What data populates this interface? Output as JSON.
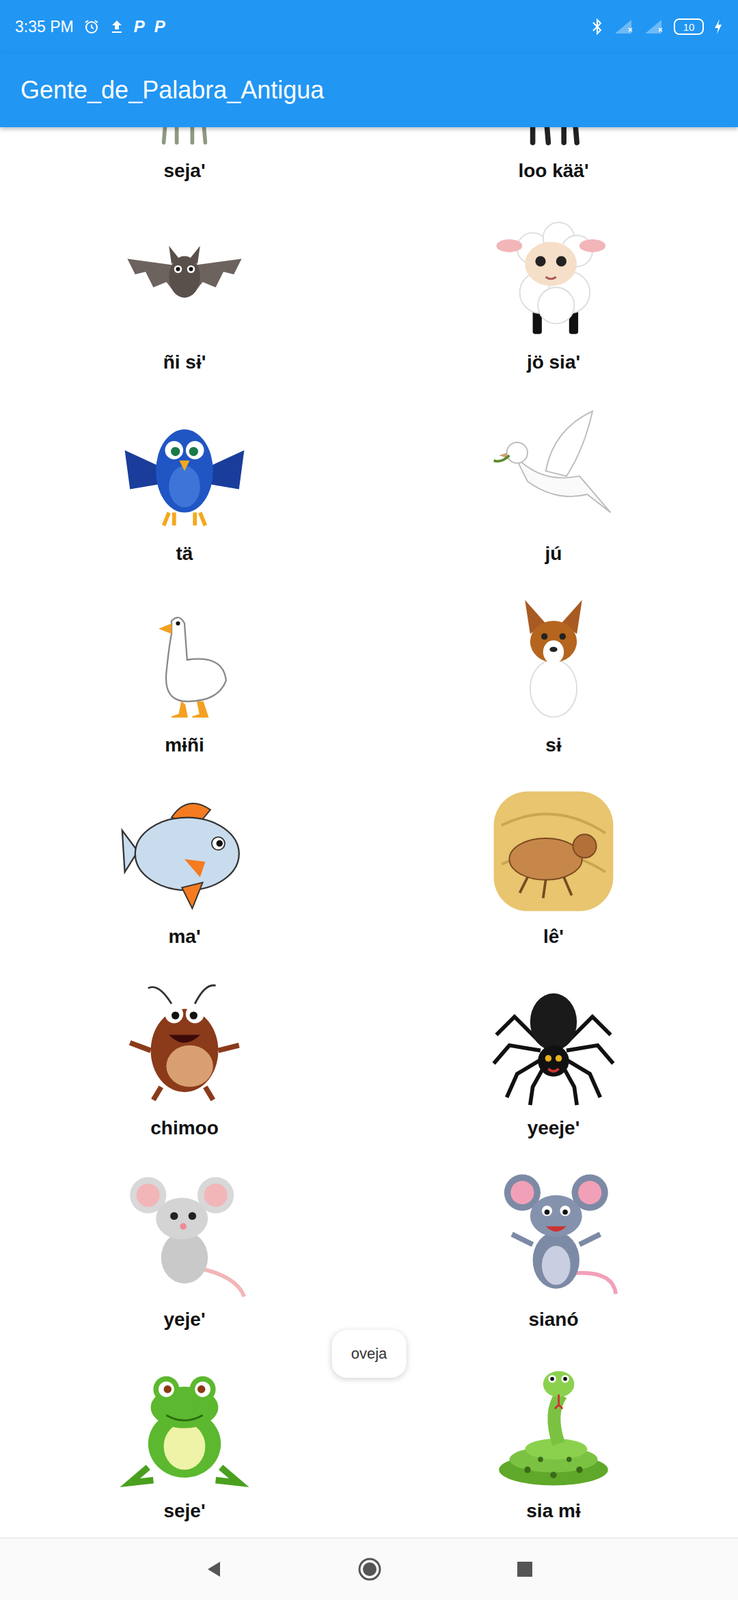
{
  "status_bar": {
    "time": "3:35 PM",
    "notifications": [
      "P",
      "P"
    ],
    "battery": "10",
    "charging": true
  },
  "app_bar": {
    "title": "Gente_de_Palabra_Antigua"
  },
  "animals": [
    {
      "label": "seja'"
    },
    {
      "label": "loo kää'"
    },
    {
      "label": "ñi sɨ'"
    },
    {
      "label": "jö sia'"
    },
    {
      "label": "tä"
    },
    {
      "label": "jú"
    },
    {
      "label": "mɨñi"
    },
    {
      "label": "sɨ"
    },
    {
      "label": "ma'"
    },
    {
      "label": "lê'"
    },
    {
      "label": "chimoo"
    },
    {
      "label": "yeeje'"
    },
    {
      "label": "yeje'"
    },
    {
      "label": "sianó"
    },
    {
      "label": "seje'"
    },
    {
      "label": "sia mɨ"
    }
  ],
  "toast": {
    "text": "oveja"
  }
}
